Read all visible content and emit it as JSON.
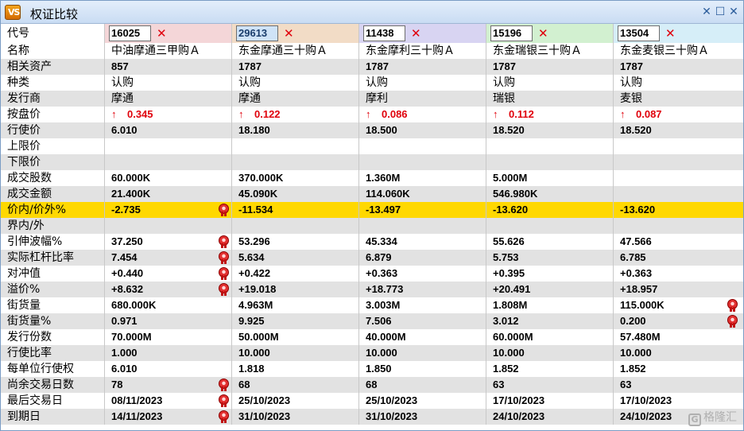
{
  "window": {
    "title": "权证比较",
    "icon_text": "VS",
    "buttons": [
      "✕",
      "☐",
      "✕"
    ]
  },
  "columns": [
    {
      "code": "16025",
      "header_color": "#f4d6d8",
      "selected": false
    },
    {
      "code": "29613",
      "header_color": "#f2dcc6",
      "selected": true
    },
    {
      "code": "11438",
      "header_color": "#d8d4f2",
      "selected": false
    },
    {
      "code": "15196",
      "header_color": "#d2f0d0",
      "selected": false
    },
    {
      "code": "13504",
      "header_color": "#d6eef8",
      "selected": false
    }
  ],
  "rows": [
    {
      "label": "代号",
      "type": "header"
    },
    {
      "label": "名称",
      "type": "cn",
      "values": [
        "中油摩通三甲购Ａ",
        "东金摩通三十购Ａ",
        "东金摩利三十购Ａ",
        "东金瑞银三十购Ａ",
        "东金麦银三十购Ａ"
      ]
    },
    {
      "label": "相关资产",
      "shaded": true,
      "values": [
        "857",
        "1787",
        "1787",
        "1787",
        "1787"
      ]
    },
    {
      "label": "种类",
      "type": "cn",
      "values": [
        "认购",
        "认购",
        "认购",
        "认购",
        "认购"
      ]
    },
    {
      "label": "发行商",
      "type": "cn",
      "shaded": true,
      "values": [
        "摩通",
        "摩通",
        "摩利",
        "瑞银",
        "麦银"
      ]
    },
    {
      "label": "按盘价",
      "type": "price",
      "values": [
        "0.345",
        "0.122",
        "0.086",
        "0.112",
        "0.087"
      ]
    },
    {
      "label": "行使价",
      "shaded": true,
      "values": [
        "6.010",
        "18.180",
        "18.500",
        "18.520",
        "18.520"
      ]
    },
    {
      "label": "上限价",
      "values": [
        "",
        "",
        "",
        "",
        ""
      ]
    },
    {
      "label": "下限价",
      "shaded": true,
      "values": [
        "",
        "",
        "",
        "",
        ""
      ]
    },
    {
      "label": "成交股数",
      "values": [
        "60.000K",
        "370.000K",
        "1.360M",
        "5.000M",
        ""
      ]
    },
    {
      "label": "成交金额",
      "shaded": true,
      "values": [
        "21.400K",
        "45.090K",
        "114.060K",
        "546.980K",
        ""
      ]
    },
    {
      "label": "价内/价外%",
      "highlight": true,
      "values": [
        "-2.735",
        "-11.534",
        "-13.497",
        "-13.620",
        "-13.620"
      ],
      "badge": [
        0
      ]
    },
    {
      "label": "界内/外",
      "shaded": true,
      "values": [
        "",
        "",
        "",
        "",
        ""
      ]
    },
    {
      "label": "引伸波幅%",
      "values": [
        "37.250",
        "53.296",
        "45.334",
        "55.626",
        "47.566"
      ],
      "badge": [
        0
      ]
    },
    {
      "label": "实际杠杆比率",
      "shaded": true,
      "values": [
        "7.454",
        "5.634",
        "6.879",
        "5.753",
        "6.785"
      ],
      "badge": [
        0
      ]
    },
    {
      "label": "对冲值",
      "values": [
        "+0.440",
        "+0.422",
        "+0.363",
        "+0.395",
        "+0.363"
      ],
      "badge": [
        0
      ]
    },
    {
      "label": "溢价%",
      "shaded": true,
      "values": [
        "+8.632",
        "+19.018",
        "+18.773",
        "+20.491",
        "+18.957"
      ],
      "badge": [
        0
      ]
    },
    {
      "label": "街货量",
      "values": [
        "680.000K",
        "4.963M",
        "3.003M",
        "1.808M",
        "115.000K"
      ],
      "badge": [
        4
      ]
    },
    {
      "label": "街货量%",
      "shaded": true,
      "values": [
        "0.971",
        "9.925",
        "7.506",
        "3.012",
        "0.200"
      ],
      "badge": [
        4
      ]
    },
    {
      "label": "发行份数",
      "values": [
        "70.000M",
        "50.000M",
        "40.000M",
        "60.000M",
        "57.480M"
      ]
    },
    {
      "label": "行使比率",
      "shaded": true,
      "values": [
        "1.000",
        "10.000",
        "10.000",
        "10.000",
        "10.000"
      ]
    },
    {
      "label": "每单位行使权",
      "values": [
        "6.010",
        "1.818",
        "1.850",
        "1.852",
        "1.852"
      ]
    },
    {
      "label": "尚余交易日数",
      "shaded": true,
      "values": [
        "78",
        "68",
        "68",
        "63",
        "63"
      ],
      "badge": [
        0
      ]
    },
    {
      "label": "最后交易日",
      "values": [
        "08/11/2023",
        "25/10/2023",
        "25/10/2023",
        "17/10/2023",
        "17/10/2023"
      ],
      "badge": [
        0
      ]
    },
    {
      "label": "到期日",
      "shaded": true,
      "values": [
        "14/11/2023",
        "31/10/2023",
        "31/10/2023",
        "24/10/2023",
        "24/10/2023"
      ],
      "badge": [
        0
      ]
    }
  ],
  "watermark": {
    "mark": "G",
    "text": "格隆汇"
  }
}
